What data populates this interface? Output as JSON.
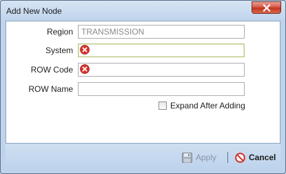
{
  "window": {
    "title": "Add New Node",
    "close_icon": "close-icon"
  },
  "form": {
    "region": {
      "label": "Region",
      "value": "TRANSMISSION"
    },
    "system": {
      "label": "System",
      "value": "",
      "status_icon": "error-icon"
    },
    "row_code": {
      "label": "ROW Code",
      "value": "",
      "status_icon": "error-icon"
    },
    "row_name": {
      "label": "ROW Name",
      "value": ""
    },
    "expand_after_adding": {
      "label": "Expand After Adding",
      "checked": false
    }
  },
  "footer": {
    "apply_label": "Apply",
    "apply_icon": "save-icon",
    "cancel_label": "Cancel",
    "cancel_icon": "cancel-icon"
  },
  "colors": {
    "error": "#d8322c",
    "close_button": "#c2361f",
    "disabled_text": "#8896a8"
  }
}
